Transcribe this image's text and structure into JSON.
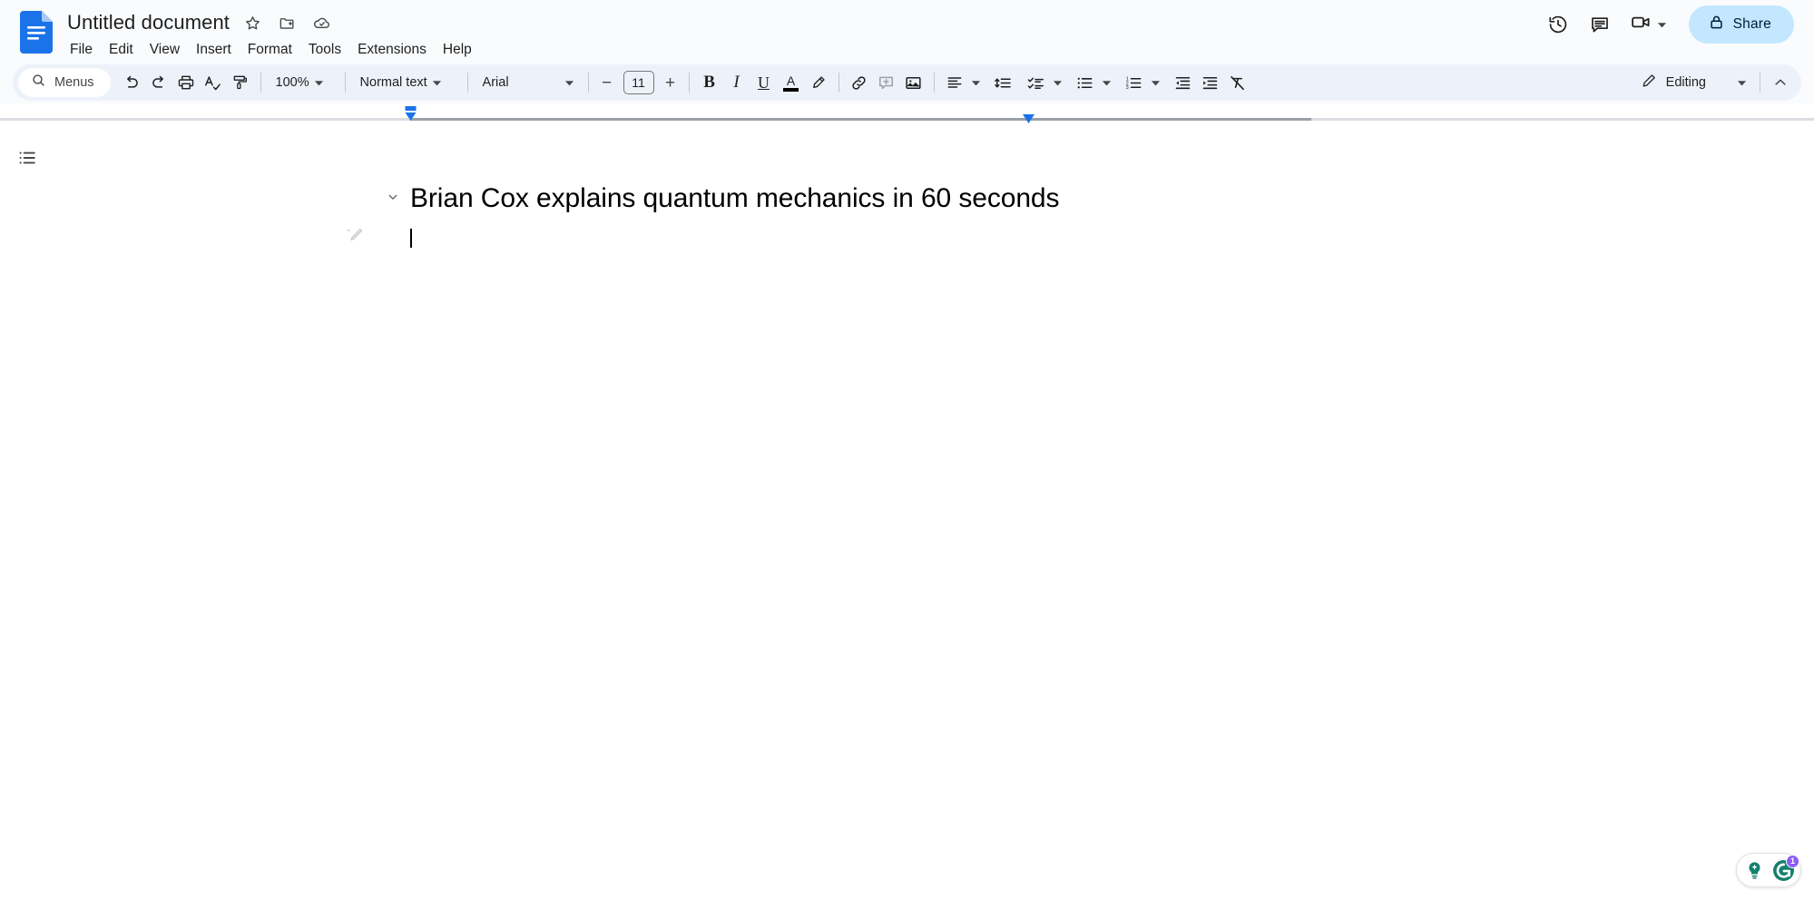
{
  "app": {
    "name": "Google Docs",
    "logo_icon": "google-docs-logo-icon"
  },
  "header": {
    "doc_title": "Untitled document",
    "title_icons": [
      {
        "name": "star-icon",
        "label": "Star"
      },
      {
        "name": "move-to-folder-icon",
        "label": "Move"
      },
      {
        "name": "cloud-saved-icon",
        "label": "See document status"
      }
    ],
    "menus": [
      {
        "label": "File"
      },
      {
        "label": "Edit"
      },
      {
        "label": "View"
      },
      {
        "label": "Insert"
      },
      {
        "label": "Format"
      },
      {
        "label": "Tools"
      },
      {
        "label": "Extensions"
      },
      {
        "label": "Help"
      }
    ],
    "right_actions": [
      {
        "name": "version-history-icon",
        "label": "Last edit"
      },
      {
        "name": "comment-history-icon",
        "label": "Open comment history"
      },
      {
        "name": "meet-camera-icon",
        "label": "Join a call"
      }
    ],
    "share": {
      "label": "Share",
      "lock_icon": "lock-icon",
      "bg": "#c2e7ff",
      "fg": "#001d35"
    }
  },
  "toolbar": {
    "search_menus": {
      "placeholder": "Menus",
      "value": "Menus",
      "icon": "search-icon"
    },
    "undo_label": "Undo",
    "redo_label": "Redo",
    "print_label": "Print",
    "spellcheck_label": "Spelling and grammar check",
    "paint_format_label": "Paint format",
    "zoom": {
      "value": "100%",
      "label": "Zoom"
    },
    "paragraph_style": {
      "value": "Normal text",
      "label": "Styles"
    },
    "font": {
      "value": "Arial",
      "label": "Font"
    },
    "font_size": {
      "value": "11",
      "decrease": "−",
      "increase": "+"
    },
    "bold_label": "B",
    "italic_label": "I",
    "underline_label": "U",
    "text_color_label": "A",
    "highlight_label": "Highlight color",
    "link_label": "Insert link",
    "comment_label": "Add comment",
    "image_label": "Insert image",
    "align_label": "Align",
    "line_spacing_label": "Line & paragraph spacing",
    "checklist_label": "Checklist",
    "bulleted_list_label": "Bulleted list",
    "numbered_list_label": "Numbered list",
    "decrease_indent_label": "Decrease indent",
    "increase_indent_label": "Increase indent",
    "clear_formatting_label": "Clear formatting",
    "mode": {
      "value": "Editing",
      "icon": "pencil-icon"
    },
    "collapse_label": "Hide the menus"
  },
  "ruler": {
    "left_indent_marker": "left-indent-marker",
    "right_indent_marker": "right-indent-marker"
  },
  "document": {
    "outline_label": "Show document outline",
    "heading": "Brian Cox explains quantum mechanics in 60 seconds",
    "body_text": "",
    "cursor_visible": true,
    "magic_icon": "magic-pen-icon"
  },
  "grammarly": {
    "suggestion_icon": "lightbulb-sparkle-icon",
    "logo_icon": "grammarly-logo-icon",
    "badge_count": "1",
    "badge_color": "#8b5cf6",
    "brand_color": "#15806c"
  }
}
